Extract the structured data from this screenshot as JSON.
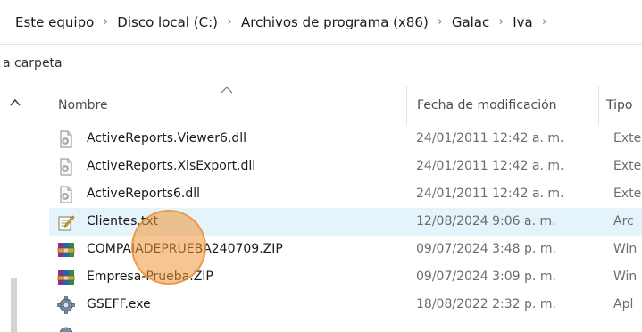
{
  "breadcrumb": {
    "items": [
      "Este equipo",
      "Disco local (C:)",
      "Archivos de programa (x86)",
      "Galac",
      "Iva"
    ],
    "separator": "›"
  },
  "toolbar": {
    "new_folder_label": "a carpeta"
  },
  "columns": {
    "name": "Nombre",
    "date": "Fecha de modificación",
    "type": "Tipo"
  },
  "files": [
    {
      "name": "ActiveReports.Viewer6.dll",
      "date": "24/01/2011 12:42 a. m.",
      "type": "Exte",
      "icon": "dll-file-icon"
    },
    {
      "name": "ActiveReports.XlsExport.dll",
      "date": "24/01/2011 12:42 a. m.",
      "type": "Exte",
      "icon": "dll-file-icon"
    },
    {
      "name": "ActiveReports6.dll",
      "date": "24/01/2011 12:42 a. m.",
      "type": "Exte",
      "icon": "dll-file-icon"
    },
    {
      "name": "Clientes.txt",
      "date": "12/08/2024 9:06 a. m.",
      "type": "Arc",
      "icon": "text-file-icon",
      "selected": true
    },
    {
      "name": "COMPAIADEPRUEBA240709.ZIP",
      "date": "09/07/2024 3:48 p. m.",
      "type": "Win",
      "icon": "zip-archive-icon"
    },
    {
      "name": "Empresa-Prueba.ZIP",
      "date": "09/07/2024 3:09 p. m.",
      "type": "Win",
      "icon": "zip-archive-icon"
    },
    {
      "name": "GSEFF.exe",
      "date": "18/08/2022 2:32 p. m.",
      "type": "Apl",
      "icon": "exe-gear-icon"
    }
  ],
  "colors": {
    "selection": "#e5f3fb",
    "click_marker": "#f0963a"
  }
}
